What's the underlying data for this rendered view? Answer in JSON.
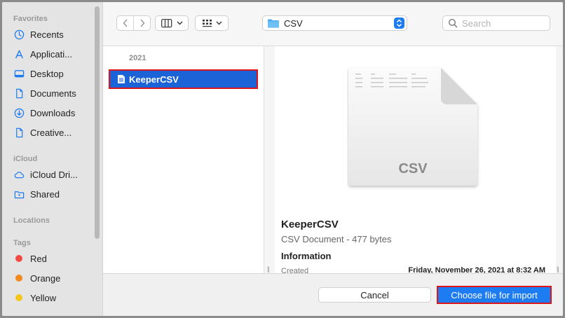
{
  "sidebar": {
    "favorites_label": "Favorites",
    "favorites": [
      {
        "label": "Recents",
        "icon": "clock-icon"
      },
      {
        "label": "Applicati...",
        "icon": "applications-icon"
      },
      {
        "label": "Desktop",
        "icon": "desktop-icon"
      },
      {
        "label": "Documents",
        "icon": "document-icon"
      },
      {
        "label": "Downloads",
        "icon": "download-icon"
      },
      {
        "label": "Creative...",
        "icon": "document-icon"
      }
    ],
    "icloud_label": "iCloud",
    "icloud": [
      {
        "label": "iCloud Dri...",
        "icon": "cloud-icon"
      },
      {
        "label": "Shared",
        "icon": "shared-folder-icon"
      }
    ],
    "locations_label": "Locations",
    "tags_label": "Tags",
    "tags": [
      {
        "label": "Red",
        "color": "#f24b46"
      },
      {
        "label": "Orange",
        "color": "#f08a21"
      },
      {
        "label": "Yellow",
        "color": "#f3c61d"
      }
    ]
  },
  "toolbar": {
    "path_label": "CSV",
    "search_placeholder": "Search"
  },
  "browser": {
    "group_label": "2021",
    "selected_file": "KeeperCSV"
  },
  "preview": {
    "doc_badge": "CSV",
    "name": "KeeperCSV",
    "kind": "CSV Document - 477 bytes",
    "info_label": "Information",
    "created_label": "Created",
    "created_value": "Friday, November 26, 2021 at 8:32 AM"
  },
  "footer": {
    "cancel_label": "Cancel",
    "choose_label": "Choose file for import"
  },
  "colors": {
    "accent": "#1e7cf3",
    "selection": "#1d63d8",
    "highlight_border": "#e0141b"
  }
}
